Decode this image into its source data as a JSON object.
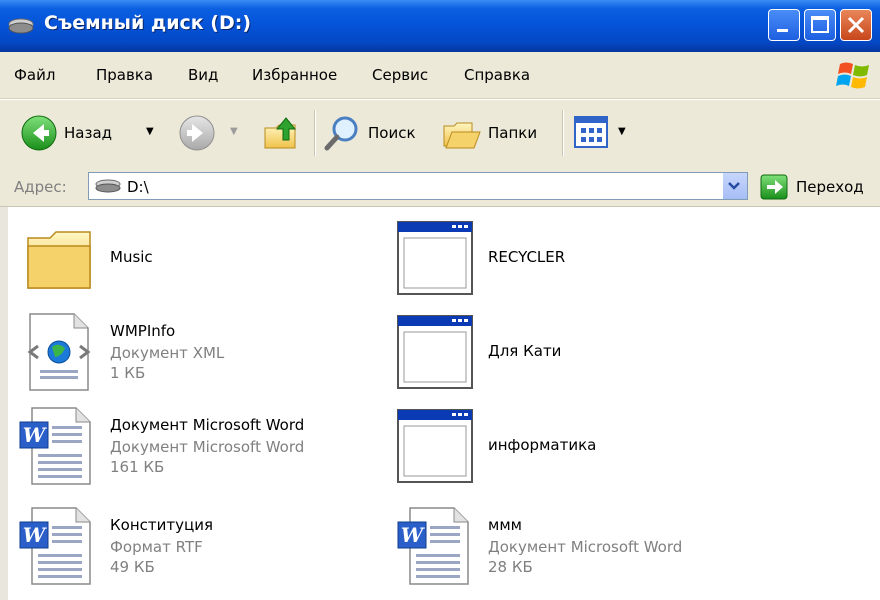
{
  "window": {
    "title": "Съемный диск (D:)"
  },
  "menu": {
    "items": [
      "Файл",
      "Правка",
      "Вид",
      "Избранное",
      "Сервис",
      "Справка"
    ]
  },
  "toolbar": {
    "back_label": "Назад",
    "search_label": "Поиск",
    "folders_label": "Папки"
  },
  "address": {
    "label": "Адрес:",
    "value": "D:\\",
    "go_label": "Переход"
  },
  "files": [
    {
      "name": "Music",
      "type": "",
      "size": "",
      "icon": "folder-icon"
    },
    {
      "name": "RECYCLER",
      "type": "",
      "size": "",
      "icon": "system-folder-icon"
    },
    {
      "name": "WMPInfo",
      "type": "Документ XML",
      "size": "1 КБ",
      "icon": "xml-document-icon"
    },
    {
      "name": "Для Кати",
      "type": "",
      "size": "",
      "icon": "system-folder-icon"
    },
    {
      "name": "Документ Microsoft Word",
      "type": "Документ Microsoft Word",
      "size": "161 КБ",
      "icon": "word-document-icon"
    },
    {
      "name": "информатика",
      "type": "",
      "size": "",
      "icon": "system-folder-icon"
    },
    {
      "name": "Конституция",
      "type": "Формат RTF",
      "size": "49 КБ",
      "icon": "word-document-icon"
    },
    {
      "name": "ммм",
      "type": "Документ Microsoft Word",
      "size": "28 КБ",
      "icon": "word-document-icon"
    }
  ]
}
